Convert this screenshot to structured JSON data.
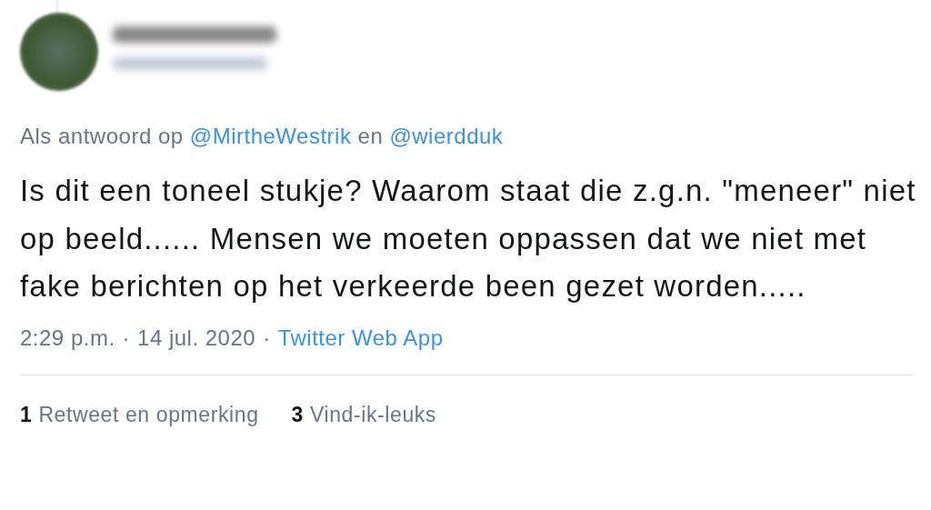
{
  "author": {
    "name_blurred": true,
    "handle_blurred": true
  },
  "reply_to": {
    "prefix": "Als antwoord op",
    "mentions": [
      "@MirtheWestrik",
      "@wierdduk"
    ],
    "joiner": "en"
  },
  "body": "Is dit een toneel stukje? Waarom staat die z.g.n. \"meneer\" niet op beeld...... Mensen we moeten oppassen dat we niet met fake berichten op het verkeerde been gezet worden.....",
  "meta": {
    "time": "2:29 p.m.",
    "separator": "·",
    "date": "14 jul. 2020",
    "source": "Twitter Web App"
  },
  "stats": [
    {
      "count": "1",
      "label": "Retweet en opmerking"
    },
    {
      "count": "3",
      "label": "Vind-ik-leuks"
    }
  ]
}
